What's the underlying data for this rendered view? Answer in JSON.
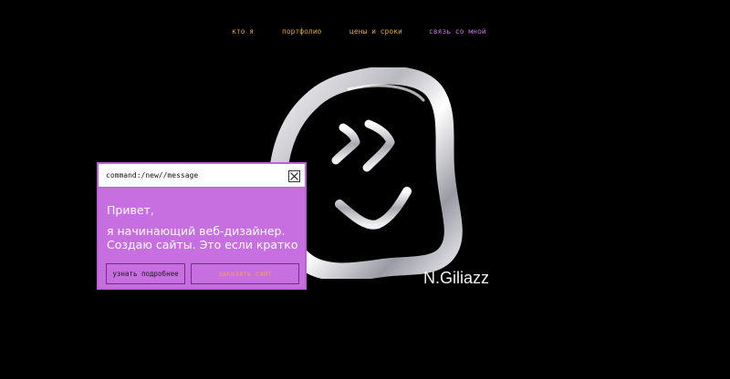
{
  "nav": {
    "items": [
      {
        "label": "кто я",
        "color": "#e0a23a"
      },
      {
        "label": "портфолио",
        "color": "#e0a23a"
      },
      {
        "label": "цены и сроки",
        "color": "#e0a23a"
      },
      {
        "label": "связь со мной",
        "color": "#c070e0"
      }
    ]
  },
  "signature": "N.Giliazz",
  "dialog": {
    "title": "command:/new//message",
    "close_icon": "close-icon",
    "greeting": "Привет,",
    "line2": "я начинающий веб-дизайнер.",
    "line3": "Создаю сайты. Это если кратко",
    "btn_more": "узнать подробнее",
    "btn_order": "заказать сайт",
    "accent": "#c76ee0"
  }
}
